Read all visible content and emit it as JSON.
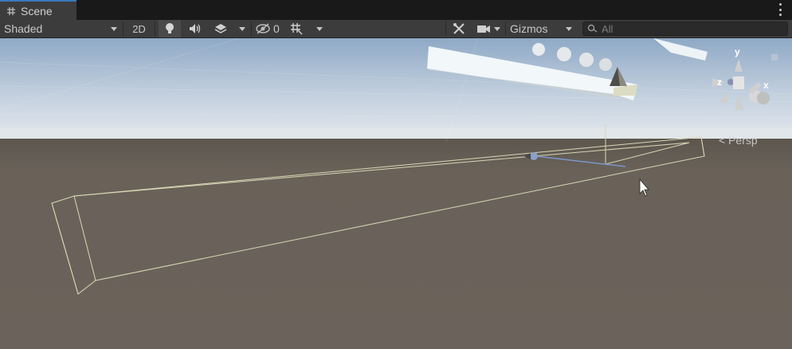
{
  "tab": {
    "label": "Scene",
    "icon": "grid-icon"
  },
  "toolbar": {
    "draw_mode": "Shaded",
    "mode_2d": "2D",
    "lighting_icon": "lightbulb-icon",
    "audio_icon": "speaker-icon",
    "effects_icon": "layers-icon",
    "hidden_count": "0",
    "hidden_icon": "eye-slash-icon",
    "grid_icon": "grid-snap-icon",
    "tools_icon": "tools-icon",
    "camera_icon": "camera-icon",
    "gizmos": "Gizmos",
    "search_placeholder": "All"
  },
  "viewport": {
    "projection_label": "< Persp",
    "axis_labels": {
      "x": "x",
      "y": "y",
      "z": "z"
    },
    "colors": {
      "sky_top": "#8fa9c6",
      "sky_horizon": "#dfe6ee",
      "ground": "#6a6259",
      "wireframe": "#d8d7b4"
    }
  }
}
